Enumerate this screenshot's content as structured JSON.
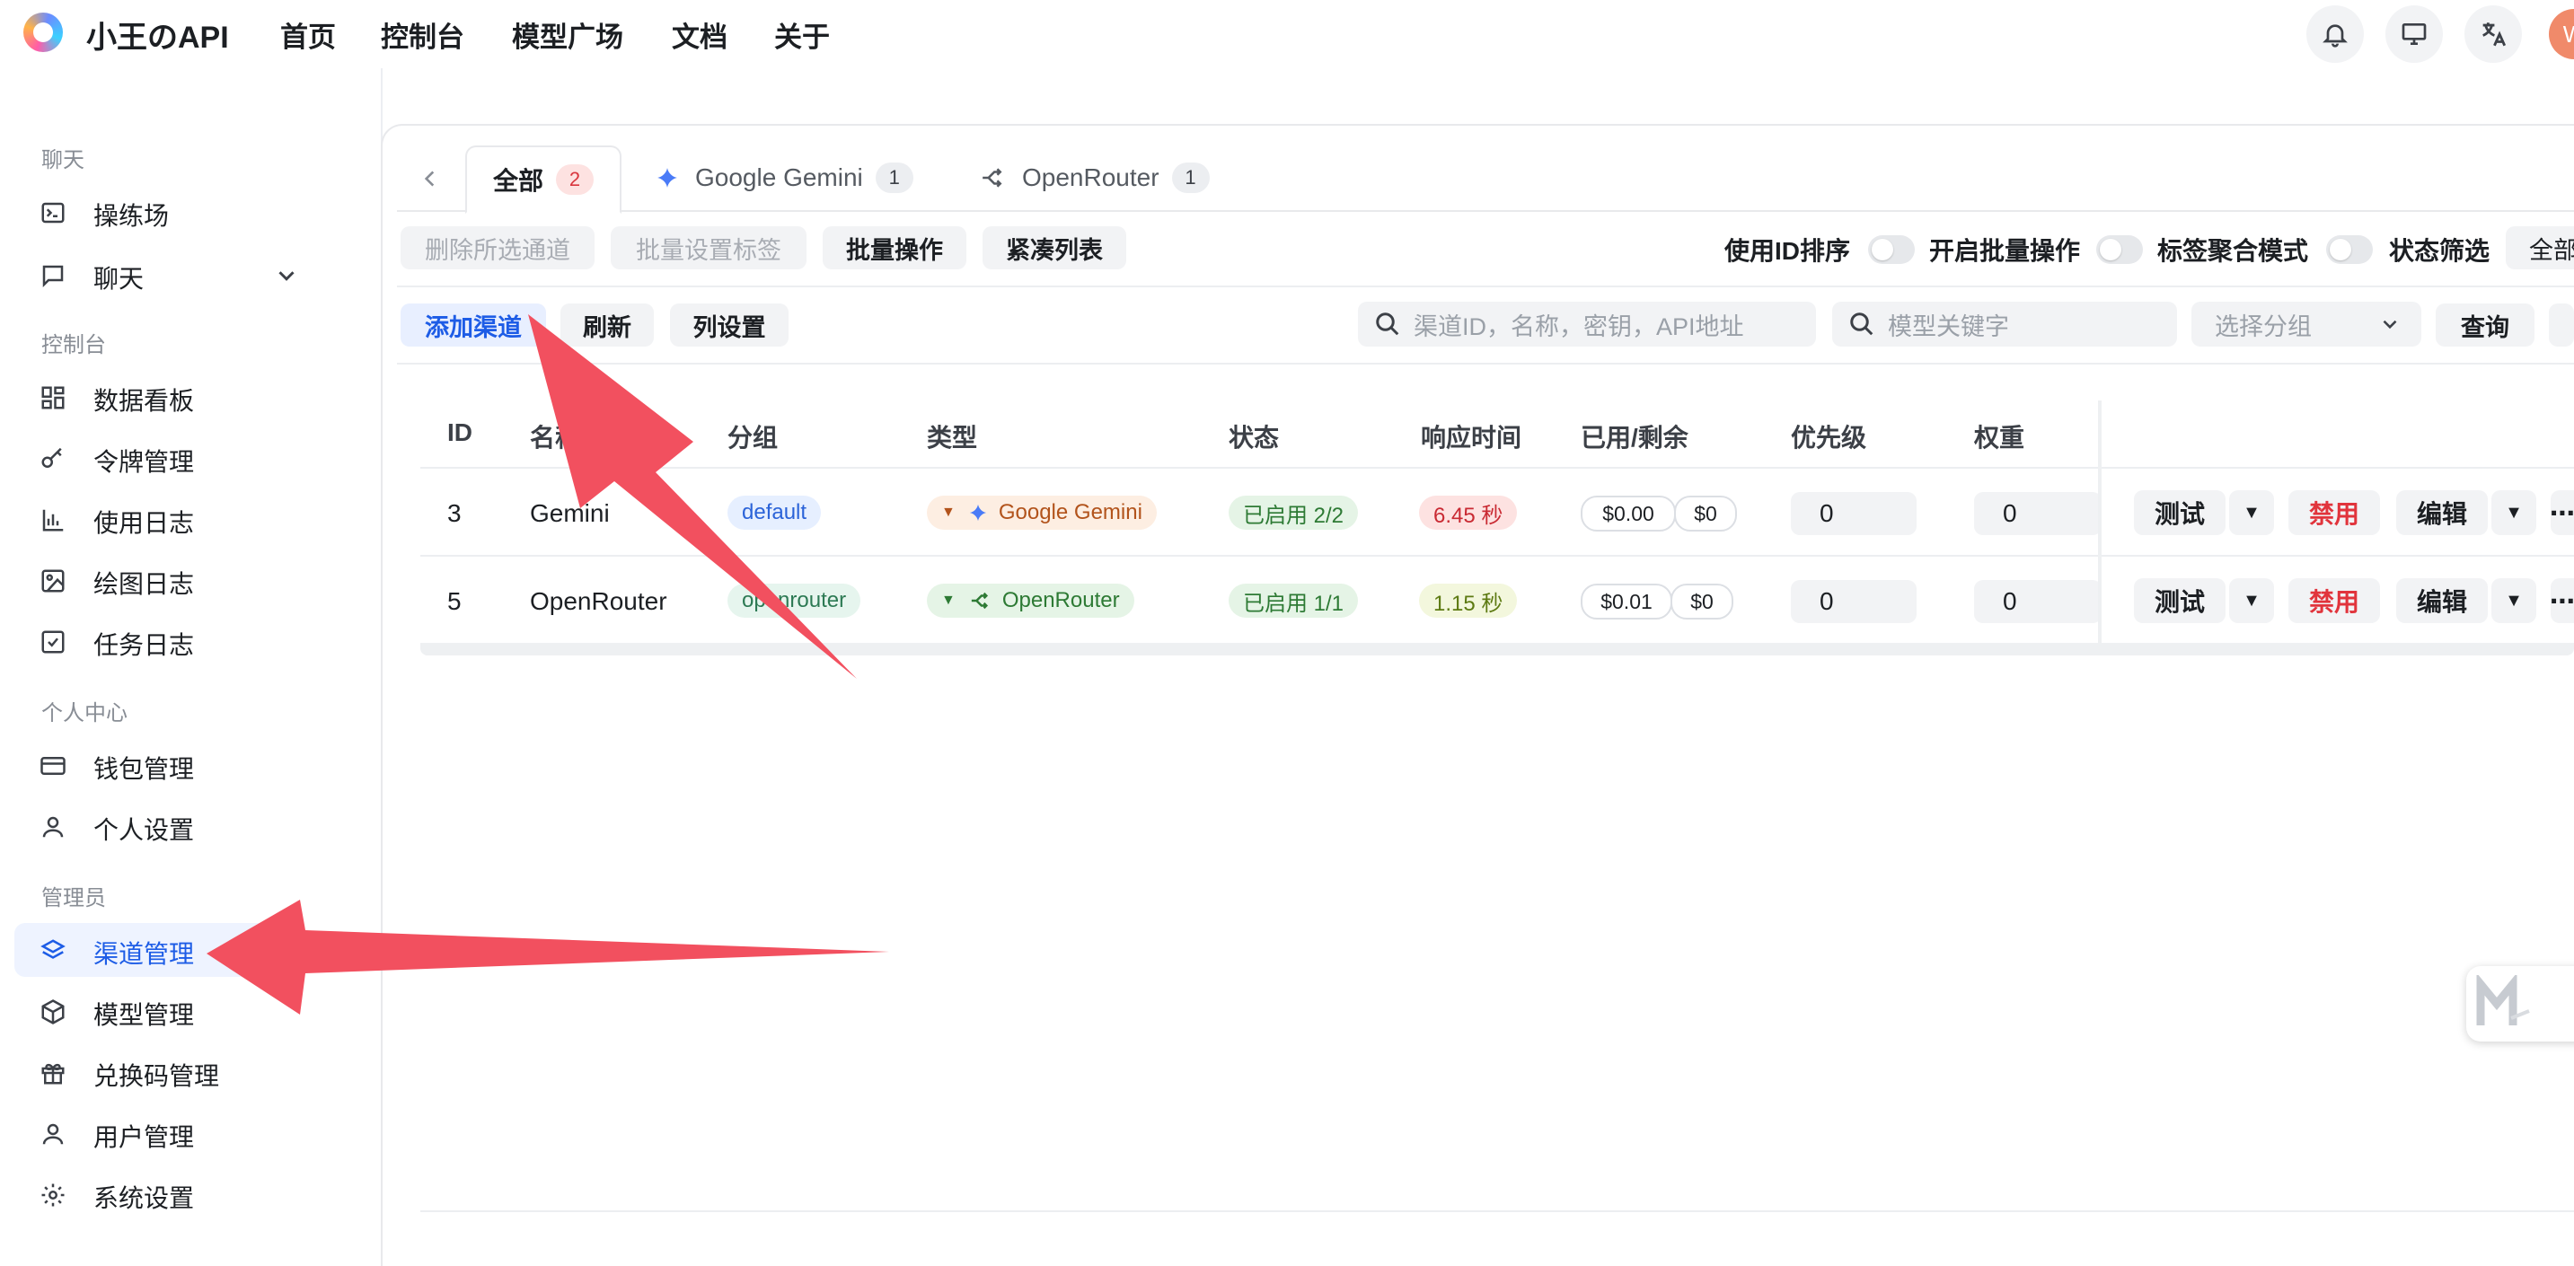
{
  "header": {
    "brand": "小王のAPI",
    "nav": [
      "首页",
      "控制台",
      "模型广场",
      "文档",
      "关于"
    ],
    "avatar_letter": "W"
  },
  "sidebar": {
    "sections": [
      {
        "title": "聊天",
        "items": [
          {
            "label": "操练场",
            "icon": "terminal-icon"
          },
          {
            "label": "聊天",
            "icon": "chat-icon"
          }
        ]
      },
      {
        "title": "控制台",
        "items": [
          {
            "label": "数据看板",
            "icon": "dashboard-icon"
          },
          {
            "label": "令牌管理",
            "icon": "key-icon"
          },
          {
            "label": "使用日志",
            "icon": "bar-chart-icon"
          },
          {
            "label": "绘图日志",
            "icon": "image-icon"
          },
          {
            "label": "任务日志",
            "icon": "checkbox-icon"
          }
        ]
      },
      {
        "title": "个人中心",
        "items": [
          {
            "label": "钱包管理",
            "icon": "wallet-icon"
          },
          {
            "label": "个人设置",
            "icon": "user-icon"
          }
        ]
      },
      {
        "title": "管理员",
        "items": [
          {
            "label": "渠道管理",
            "icon": "layers-icon"
          },
          {
            "label": "模型管理",
            "icon": "cube-icon"
          },
          {
            "label": "兑换码管理",
            "icon": "gift-icon"
          },
          {
            "label": "用户管理",
            "icon": "user-icon"
          },
          {
            "label": "系统设置",
            "icon": "gear-icon"
          }
        ]
      }
    ]
  },
  "tabs": [
    {
      "label": "全部",
      "count": "2"
    },
    {
      "label": "Google Gemini",
      "count": "1"
    },
    {
      "label": "OpenRouter",
      "count": "1"
    }
  ],
  "toolbar": {
    "delete_selected": "删除所选通道",
    "batch_tag": "批量设置标签",
    "batch_ops": "批量操作",
    "compact": "紧凑列表",
    "sort_by_id": "使用ID排序",
    "enable_batch": "开启批量操作",
    "tag_agg": "标签聚合模式",
    "status_filter": "状态筛选",
    "status_value": "全部"
  },
  "actions": {
    "add": "添加渠道",
    "refresh": "刷新",
    "columns": "列设置",
    "search_placeholder": "渠道ID，名称，密钥，API地址",
    "model_placeholder": "模型关键字",
    "group_placeholder": "选择分组",
    "query": "查询"
  },
  "table": {
    "headers": [
      "ID",
      "名称",
      "分组",
      "类型",
      "状态",
      "响应时间",
      "已用/剩余",
      "优先级",
      "权重"
    ],
    "rows": [
      {
        "id": "3",
        "name": "Gemini",
        "group": "default",
        "type": "Google Gemini",
        "status": "已启用 2/2",
        "latency": "6.45 秒",
        "used": "$0.00",
        "remain": "$0",
        "priority": "0",
        "weight": "0",
        "test": "测试",
        "disable": "禁用",
        "edit": "编辑"
      },
      {
        "id": "5",
        "name": "OpenRouter",
        "group": "openrouter",
        "type": "OpenRouter",
        "status": "已启用 1/1",
        "latency": "1.15 秒",
        "used": "$0.01",
        "remain": "$0",
        "priority": "0",
        "weight": "0",
        "test": "测试",
        "disable": "禁用",
        "edit": "编辑"
      }
    ]
  },
  "colors": {
    "accent": "#1d5ce6",
    "annotation_arrow": "#f2505f",
    "danger": "#e1343c"
  }
}
